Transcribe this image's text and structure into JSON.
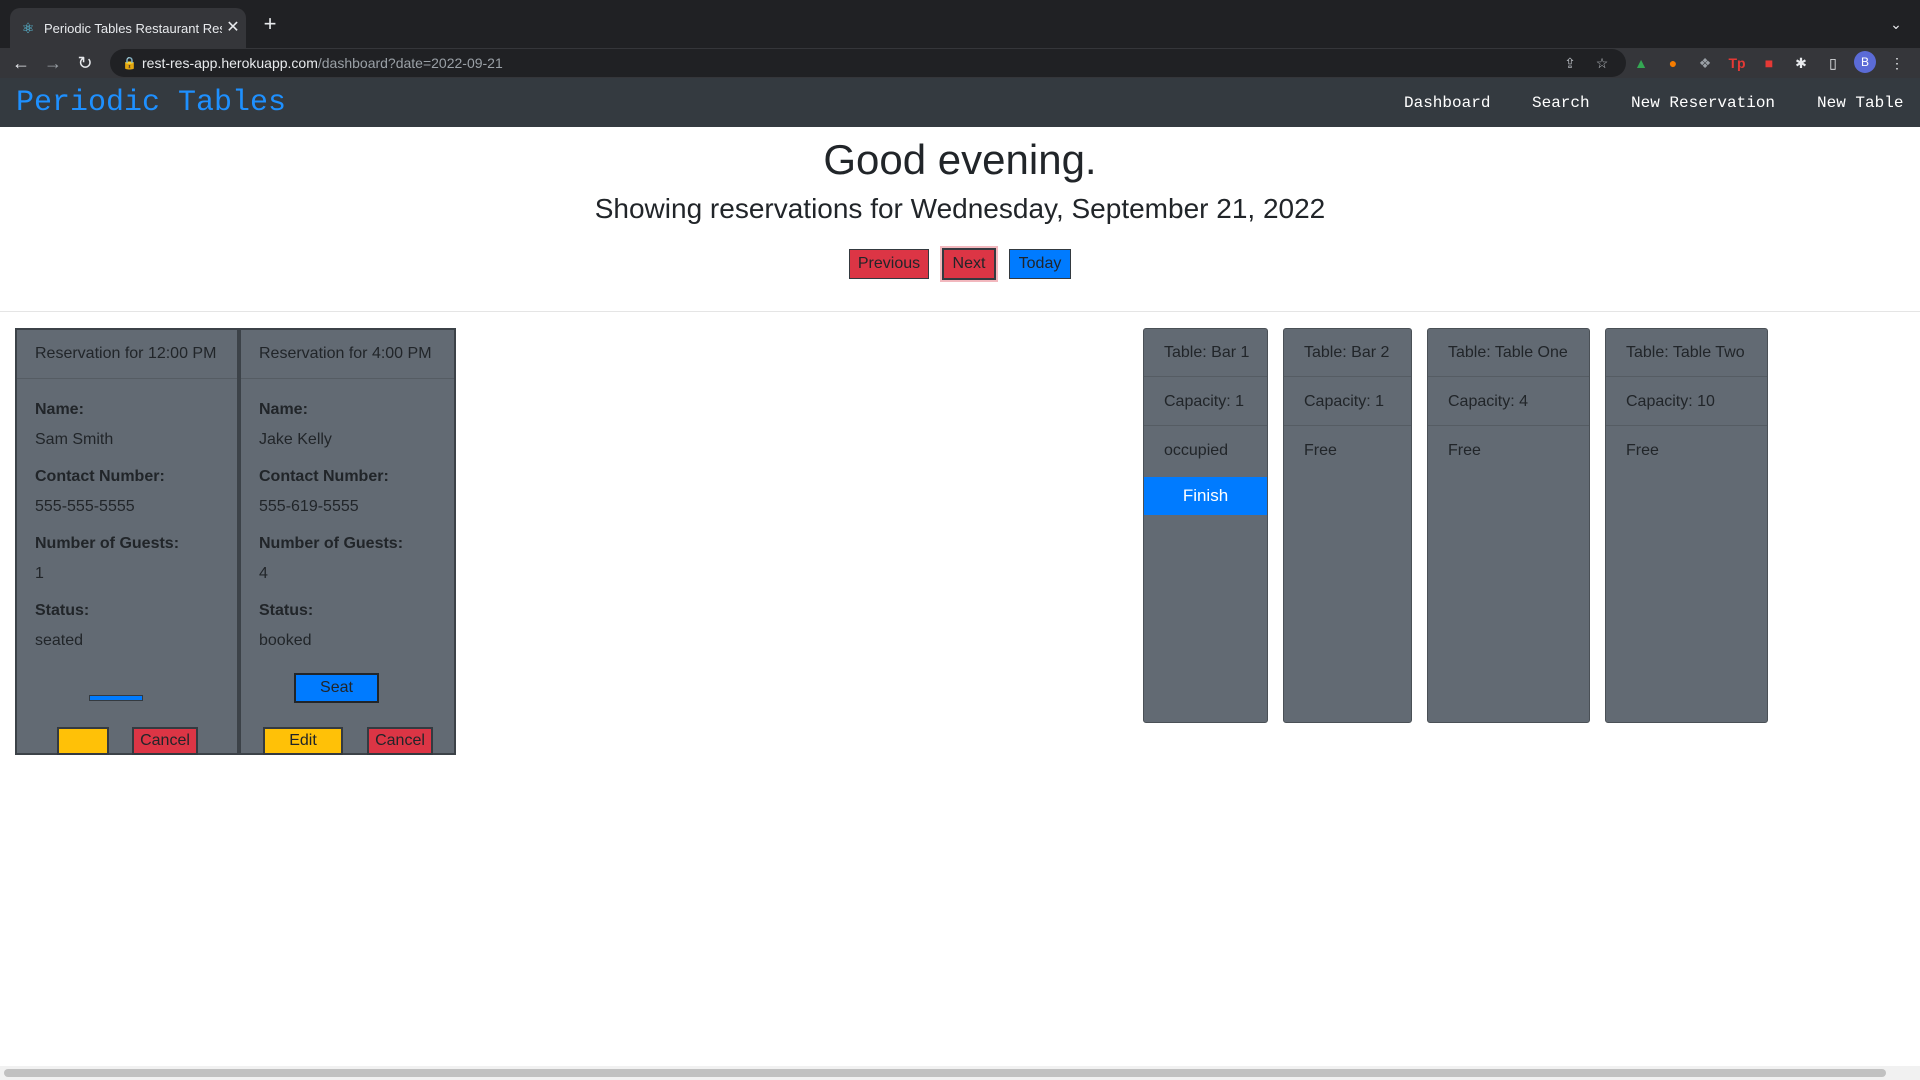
{
  "browser": {
    "tab_title": "Periodic Tables Restaurant Res",
    "url_host": "rest-res-app.herokuapp.com",
    "url_path": "/dashboard?date=2022-09-21",
    "profile_initial": "B"
  },
  "navbar": {
    "brand": "Periodic Tables",
    "links": [
      "Dashboard",
      "Search",
      "New Reservation",
      "New Table"
    ]
  },
  "header": {
    "greeting": "Good evening.",
    "date_line": "Showing reservations for Wednesday, September 21, 2022",
    "buttons": {
      "previous": "Previous",
      "next": "Next",
      "today": "Today"
    }
  },
  "reservations": [
    {
      "title": "Reservation for 12:00 PM",
      "name_label": "Name:",
      "name": "Sam Smith",
      "contact_label": "Contact Number:",
      "contact": "555-555-5555",
      "guests_label": "Number of Guests:",
      "guests": "1",
      "status_label": "Status:",
      "status": "seated",
      "edit_label": "",
      "cancel_label": "Cancel"
    },
    {
      "title": "Reservation for 4:00 PM",
      "name_label": "Name:",
      "name": "Jake Kelly",
      "contact_label": "Contact Number:",
      "contact": "555-619-5555",
      "guests_label": "Number of Guests:",
      "guests": "4",
      "status_label": "Status:",
      "status": "booked",
      "seat_label": "Seat",
      "edit_label": "Edit",
      "cancel_label": "Cancel"
    }
  ],
  "tables": [
    {
      "title": "Table: Bar 1",
      "capacity": "Capacity: 1",
      "status": "occupied",
      "finish_label": "Finish"
    },
    {
      "title": "Table: Bar 2",
      "capacity": "Capacity: 1",
      "status": "Free"
    },
    {
      "title": "Table: Table One",
      "capacity": "Capacity: 4",
      "status": "Free"
    },
    {
      "title": "Table: Table Two",
      "capacity": "Capacity: 10",
      "status": "Free"
    }
  ],
  "colors": {
    "navbar": "#343a40",
    "brand": "#1e90ff",
    "card": "#626a73",
    "danger": "#dc3545",
    "primary": "#007bff",
    "warning": "#ffc107"
  },
  "icons": [
    "react-icon",
    "close-icon",
    "plus-icon",
    "back-arrow-icon",
    "forward-arrow-icon",
    "reload-icon",
    "lock-icon",
    "share-icon",
    "star-icon",
    "google-drive-icon",
    "extension-icon",
    "puzzle-icon",
    "side-panel-icon",
    "kebab-menu-icon"
  ]
}
